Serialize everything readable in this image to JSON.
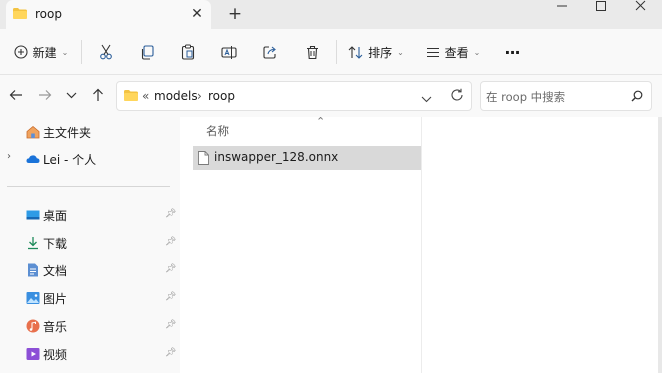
{
  "tab": {
    "title": "roop",
    "close_glyph": "✕",
    "new_glyph": "+"
  },
  "toolbar": {
    "new_label": "新建",
    "sort_label": "排序",
    "view_label": "查看",
    "more_glyph": "···"
  },
  "address": {
    "overflow": "«",
    "crumbs": [
      "models",
      "roop"
    ],
    "separator": "›"
  },
  "search": {
    "placeholder": "在 roop 中搜索"
  },
  "sidebar": {
    "items": [
      {
        "label": "主文件夹",
        "icon": "home-icon"
      },
      {
        "label": "Lei - 个人",
        "icon": "onedrive-cloud-icon"
      },
      {
        "label": "桌面",
        "icon": "desktop-icon",
        "pinned": true
      },
      {
        "label": "下载",
        "icon": "download-icon",
        "pinned": true
      },
      {
        "label": "文档",
        "icon": "documents-icon",
        "pinned": true
      },
      {
        "label": "图片",
        "icon": "pictures-icon",
        "pinned": true
      },
      {
        "label": "音乐",
        "icon": "music-icon",
        "pinned": true
      },
      {
        "label": "视频",
        "icon": "videos-icon",
        "pinned": true
      }
    ],
    "pin_glyph": "📌"
  },
  "content": {
    "column_name": "名称",
    "sort_glyph": "⌃",
    "files": [
      {
        "name": "inswapper_128.onnx"
      }
    ]
  },
  "colors": {
    "accent": "#0067c0",
    "folder": "#f3c342",
    "selection": "#d9d9d9"
  }
}
